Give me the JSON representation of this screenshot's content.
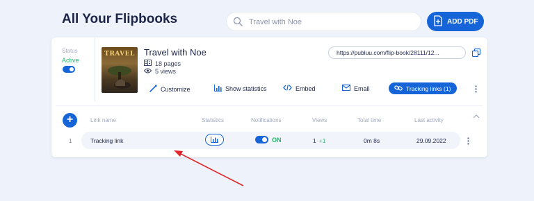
{
  "header": {
    "title": "All Your Flipbooks",
    "search_placeholder": "Travel with Noe",
    "add_pdf_label": "ADD PDF"
  },
  "flipbook": {
    "status_label": "Status",
    "status_value": "Active",
    "cover_text": "TRAVEL",
    "title": "Travel with Noe",
    "pages": "18 pages",
    "views": "5 views",
    "url": "https://publuu.com/flip-book/28111/12...",
    "actions": {
      "customize": "Customize",
      "show_statistics": "Show statistics",
      "embed": "Embed",
      "email": "Email",
      "tracking_links": "Tracking links (1)"
    }
  },
  "tracking_table": {
    "columns": [
      "Link name",
      "Statistics",
      "Notifications",
      "Views",
      "Total time",
      "Last activity"
    ],
    "rows": [
      {
        "index": "1",
        "link_name": "Tracking link",
        "notifications": "ON",
        "views": "1",
        "views_delta": "+1",
        "total_time": "0m 8s",
        "last_activity": "29.09.2022"
      }
    ]
  },
  "colors": {
    "accent": "#1565d8",
    "active_green": "#21b36b",
    "annotation_arrow": "#e0262b",
    "background": "#eef3fb"
  },
  "icons": [
    "search-icon",
    "add-pdf-icon",
    "pages-icon",
    "eye-icon",
    "copy-icon",
    "brush-icon",
    "chart-icon",
    "code-icon",
    "mail-icon",
    "link-icon",
    "kebab-icon",
    "plus-icon",
    "chevron-up-icon"
  ]
}
